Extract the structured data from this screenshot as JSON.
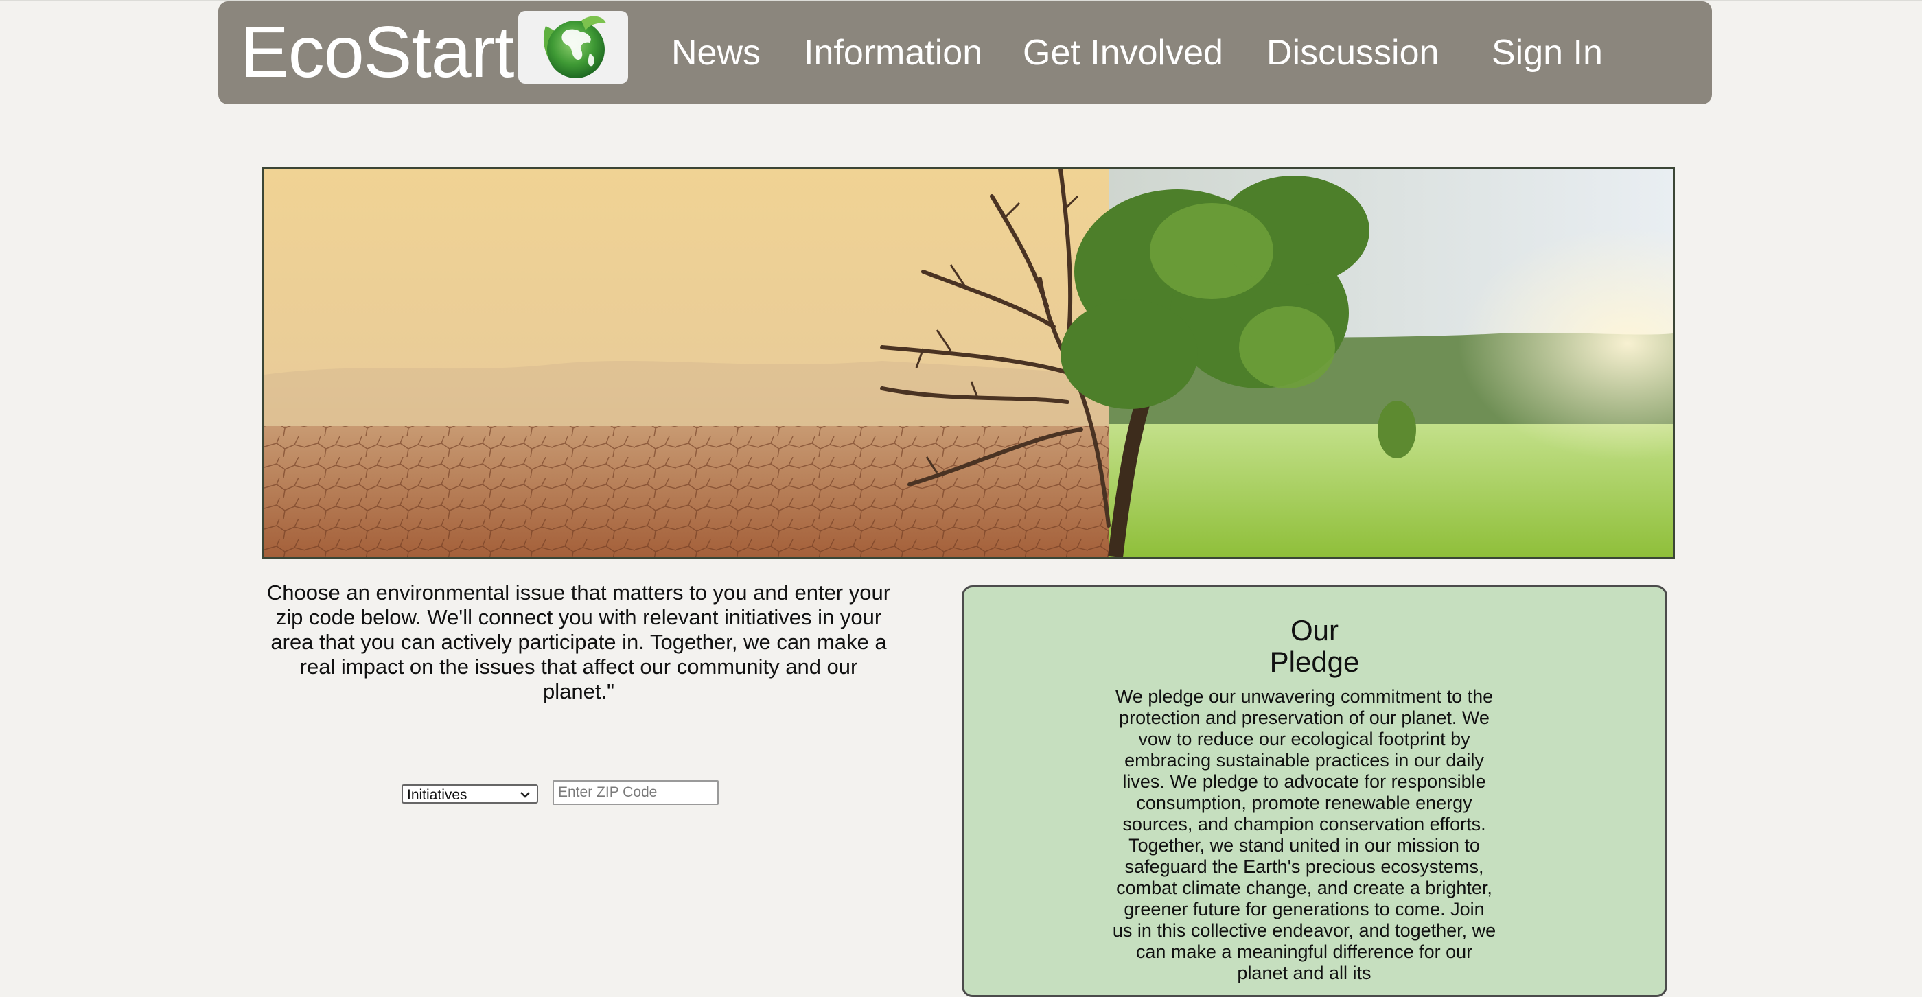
{
  "header": {
    "brand": "EcoStart",
    "nav": [
      {
        "label": "News"
      },
      {
        "label": "Information"
      },
      {
        "label": "Get Involved"
      },
      {
        "label": "Discussion"
      },
      {
        "label": "Sign In"
      }
    ]
  },
  "intro": {
    "text": "Choose an environmental issue that matters to you and enter your zip code below. We'll connect you with relevant initiatives in your area that you can actively participate in. Together, we can make a real impact on the issues that affect our community and our planet.\""
  },
  "search": {
    "category_selected": "Initiatives",
    "zip_placeholder": "Enter ZIP Code"
  },
  "pledge": {
    "title_line1": "Our",
    "title_line2": "Pledge",
    "body": "We pledge our unwavering commitment to the protection and preservation of our planet. We vow to reduce our ecological footprint by embracing sustainable practices in our daily lives. We pledge to advocate for responsible consumption, promote renewable energy sources, and champion conservation efforts. Together, we stand united in our mission to safeguard the Earth's precious ecosystems, combat climate change, and create a brighter, greener future for generations to come. Join us in this collective endeavor, and together, we can make a meaningful difference for our planet and all its"
  },
  "icons": {
    "logo": "globe-leaf-icon",
    "select_arrow": "chevron-down-icon"
  },
  "colors": {
    "header_bg": "#8b867d",
    "page_bg": "#f3f2ef",
    "pledge_bg": "#c6dfbf",
    "logo_green": "#3f9a35"
  }
}
